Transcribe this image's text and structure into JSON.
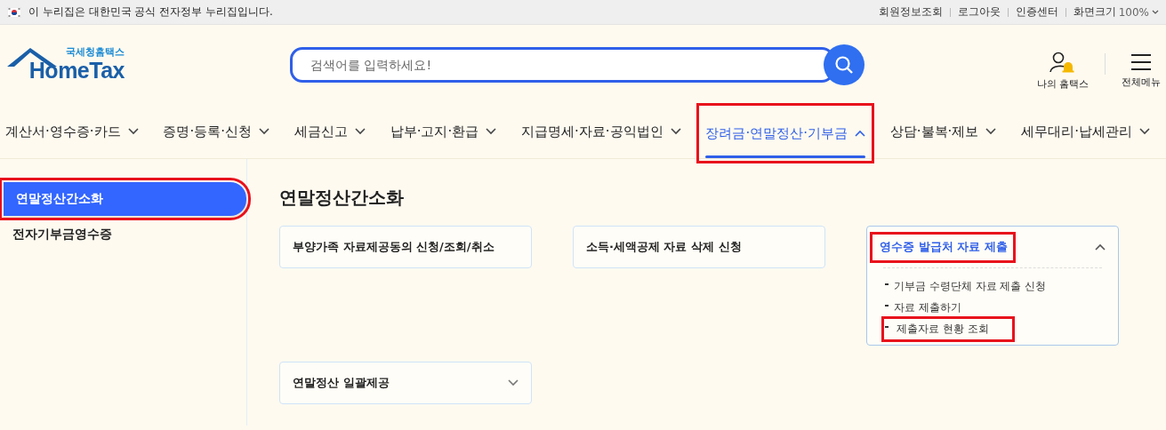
{
  "top_bar": {
    "notice": "이 누리집은 대한민국 공식 전자정부 누리집입니다.",
    "links": [
      "회원정보조회",
      "로그아웃",
      "인증센터"
    ],
    "zoom_label": "화면크기",
    "zoom_value": "100%"
  },
  "header": {
    "logo_small": "국세청홈택스",
    "logo_main": "HomeTax",
    "search": {
      "placeholder": "검색어를 입력하세요!"
    },
    "my_label": "나의 홈택스",
    "menu_label": "전체메뉴"
  },
  "nav": [
    {
      "label": "계산서·영수증·카드",
      "selected": false,
      "highlighted": false
    },
    {
      "label": "증명·등록·신청",
      "selected": false,
      "highlighted": false
    },
    {
      "label": "세금신고",
      "selected": false,
      "highlighted": false
    },
    {
      "label": "납부·고지·환급",
      "selected": false,
      "highlighted": false
    },
    {
      "label": "지급명세·자료·공익법인",
      "selected": false,
      "highlighted": false
    },
    {
      "label": "장려금·연말정산·기부금",
      "selected": true,
      "highlighted": true
    },
    {
      "label": "상담·불복·제보",
      "selected": false,
      "highlighted": false
    },
    {
      "label": "세무대리·납세관리",
      "selected": false,
      "highlighted": false
    }
  ],
  "sidebar": {
    "items": [
      {
        "label": "연말정산간소화",
        "selected": true,
        "highlighted": true
      },
      {
        "label": "전자기부금영수증",
        "selected": false,
        "highlighted": false
      }
    ]
  },
  "content": {
    "title": "연말정산간소화",
    "cards": [
      {
        "kind": "link",
        "title": "부양가족 자료제공동의 신청/조회/취소",
        "highlighted": false
      },
      {
        "kind": "link",
        "title": "소득·세액공제 자료 삭제 신청",
        "highlighted": false
      },
      {
        "kind": "accordion",
        "title": "영수증 발급처 자료 제출",
        "expanded": true,
        "highlighted": true,
        "children": [
          {
            "label": "기부금 수령단체 자료 제출 신청",
            "highlighted": false
          },
          {
            "label": "자료 제출하기",
            "highlighted": false
          },
          {
            "label": "제출자료 현황 조회",
            "highlighted": true
          }
        ]
      },
      {
        "kind": "accordion",
        "title": "연말정산 일괄제공",
        "expanded": false,
        "highlighted": false
      }
    ]
  }
}
